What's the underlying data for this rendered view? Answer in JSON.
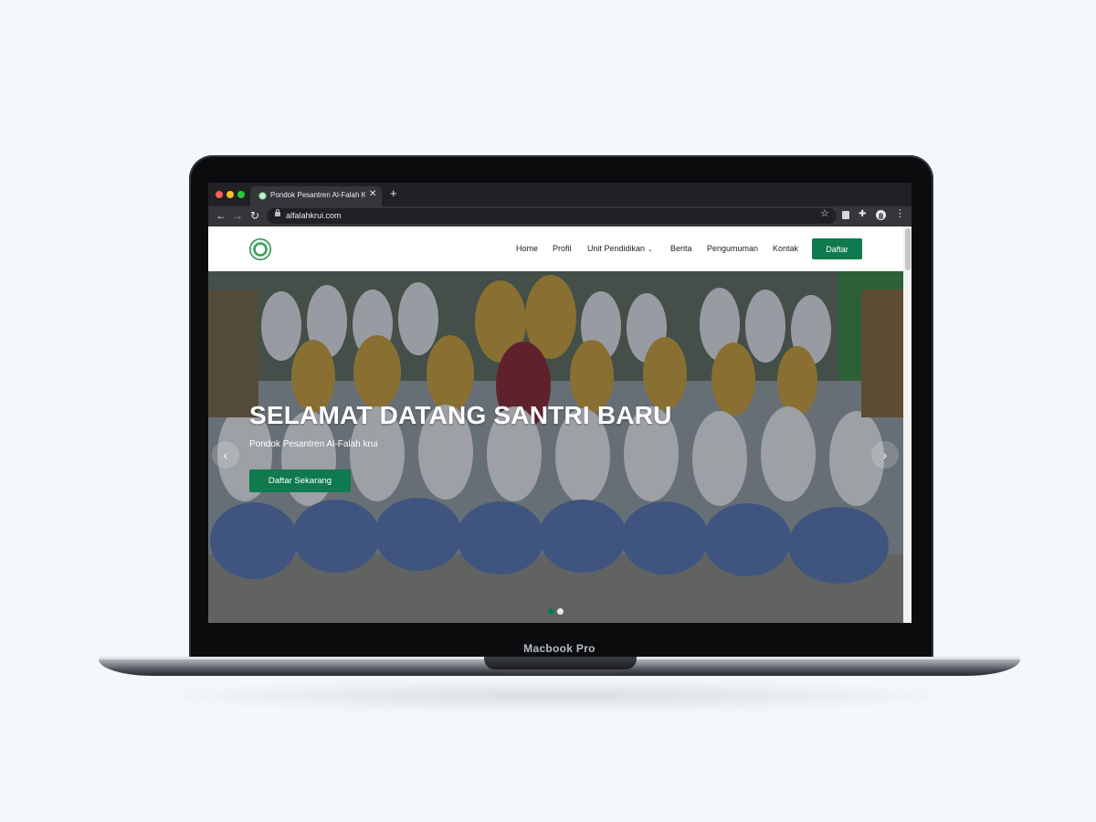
{
  "device": {
    "label": "Macbook Pro"
  },
  "browser": {
    "tab": {
      "title": "Pondok Pesantren Al-Falah Krui",
      "close": "✕"
    },
    "new_tab": "+",
    "nav": {
      "back": "←",
      "forward": "→",
      "reload": "↻"
    },
    "address": "alfalahkrui.com",
    "icons": [
      "lock-icon",
      "star-icon",
      "extension-icon",
      "puzzle-icon",
      "profile-icon",
      "kebab-menu-icon"
    ]
  },
  "site": {
    "nav": {
      "items": [
        "Home",
        "Profil",
        "Unit Pendidikan",
        "Berita",
        "Pengumuman",
        "Kontak"
      ],
      "dropdown_chevron": "⌄",
      "cta": "Daftar"
    },
    "hero": {
      "title": "SELAMAT DATANG SANTRI BARU",
      "subtitle": "Pondok Pesantren Al-Falah krui",
      "cta": "Daftar Sekarang",
      "prev": "‹",
      "next": "›",
      "slides": 2,
      "active_slide": 1
    }
  },
  "colors": {
    "brand_green": "#0e7a4e",
    "chrome_dark": "#202124",
    "chrome_toolbar": "#35363a"
  }
}
